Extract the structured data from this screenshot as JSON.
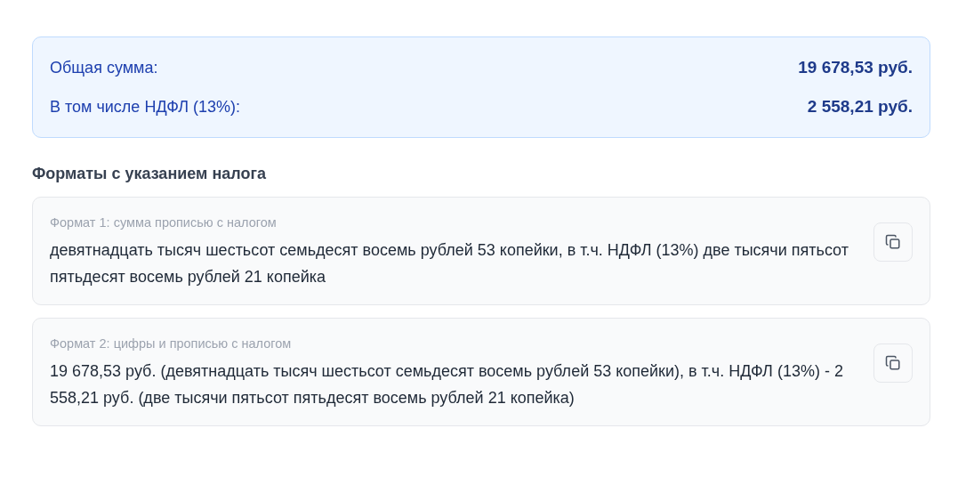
{
  "summary": {
    "rows": [
      {
        "label": "Общая сумма:",
        "value": "19 678,53 руб."
      },
      {
        "label": "В том числе НДФЛ (13%):",
        "value": "2 558,21 руб."
      }
    ]
  },
  "section_title": "Форматы с указанием налога",
  "formats": [
    {
      "label": "Формат 1: сумма прописью с налогом",
      "text": "девятнадцать тысяч шестьсот семьдесят восемь рублей 53 копейки, в т.ч. НДФЛ (13%) две тысячи пятьсот пятьдесят восемь рублей 21 копейка"
    },
    {
      "label": "Формат 2: цифры и прописью с налогом",
      "text": "19 678,53 руб. (девятнадцать тысяч шестьсот семьдесят восемь рублей 53 копейки), в т.ч. НДФЛ (13%) - 2 558,21 руб. (две тысячи пятьсот пятьдесят восемь рублей 21 копейка)"
    }
  ]
}
